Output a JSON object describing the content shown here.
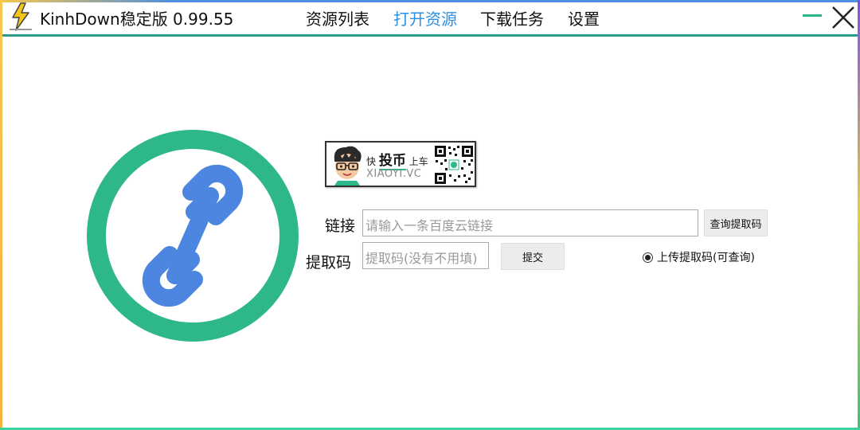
{
  "app": {
    "title": "KinhDown稳定版 0.99.55"
  },
  "nav": {
    "items": [
      {
        "label": "资源列表",
        "active": false
      },
      {
        "label": "打开资源",
        "active": true
      },
      {
        "label": "下载任务",
        "active": false
      },
      {
        "label": "设置",
        "active": false
      }
    ]
  },
  "window_controls": {
    "minimize_icon": "minimize-icon",
    "close_icon": "close-icon"
  },
  "banner": {
    "small_left": "快",
    "big": "投币",
    "small_right": "上车",
    "site": "XIAOYI.VC"
  },
  "form": {
    "link_label": "链接",
    "link_placeholder": "请输入一条百度云链接",
    "link_value": "",
    "query_code_button": "查询提取码",
    "code_label": "提取码",
    "code_placeholder": "提取码(没有不用填)",
    "code_value": "",
    "submit_button": "提交",
    "upload_code_option": "上传提取码(可查询)",
    "upload_code_checked": true
  },
  "colors": {
    "accent_nav": "#2a8fe6",
    "divider": "#2e9c8c",
    "logo_ring": "#2eb88a",
    "logo_link": "#4d86e0"
  }
}
